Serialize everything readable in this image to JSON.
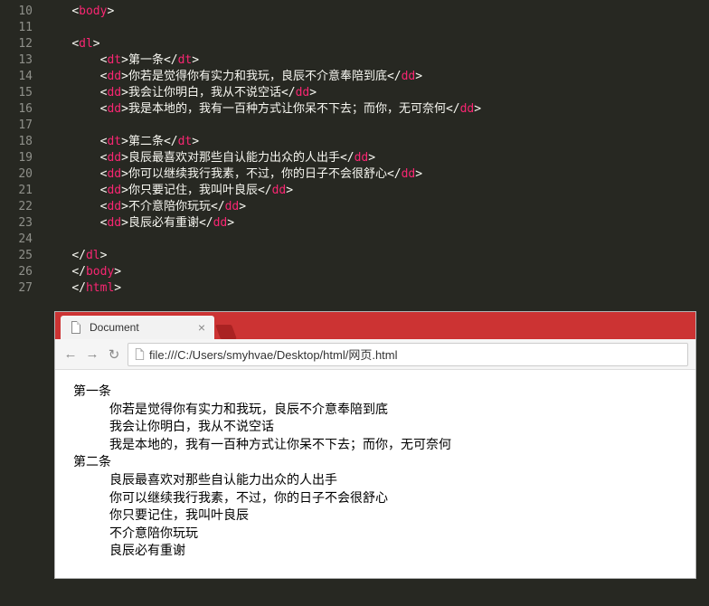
{
  "editor": {
    "lines": [
      {
        "n": 10,
        "indent": 1,
        "type": "open",
        "tag": "body"
      },
      {
        "n": 11,
        "indent": 0,
        "type": "blank"
      },
      {
        "n": 12,
        "indent": 1,
        "type": "open",
        "tag": "dl"
      },
      {
        "n": 13,
        "indent": 2,
        "type": "wrap",
        "tag": "dt",
        "text": "第一条"
      },
      {
        "n": 14,
        "indent": 2,
        "type": "wrap",
        "tag": "dd",
        "text": "你若是觉得你有实力和我玩，良辰不介意奉陪到底"
      },
      {
        "n": 15,
        "indent": 2,
        "type": "wrap",
        "tag": "dd",
        "text": "我会让你明白，我从不说空话"
      },
      {
        "n": 16,
        "indent": 2,
        "type": "wrap",
        "tag": "dd",
        "text": "我是本地的，我有一百种方式让你呆不下去；而你，无可奈何"
      },
      {
        "n": 17,
        "indent": 0,
        "type": "blank"
      },
      {
        "n": 18,
        "indent": 2,
        "type": "wrap",
        "tag": "dt",
        "text": "第二条"
      },
      {
        "n": 19,
        "indent": 2,
        "type": "wrap",
        "tag": "dd",
        "text": "良辰最喜欢对那些自认能力出众的人出手"
      },
      {
        "n": 20,
        "indent": 2,
        "type": "wrap",
        "tag": "dd",
        "text": "你可以继续我行我素，不过，你的日子不会很舒心"
      },
      {
        "n": 21,
        "indent": 2,
        "type": "wrap",
        "tag": "dd",
        "text": "你只要记住，我叫叶良辰"
      },
      {
        "n": 22,
        "indent": 2,
        "type": "wrap",
        "tag": "dd",
        "text": "不介意陪你玩玩"
      },
      {
        "n": 23,
        "indent": 2,
        "type": "wrap",
        "tag": "dd",
        "text": "良辰必有重谢"
      },
      {
        "n": 24,
        "indent": 0,
        "type": "blank"
      },
      {
        "n": 25,
        "indent": 1,
        "type": "close",
        "tag": "dl"
      },
      {
        "n": 26,
        "indent": 1,
        "type": "close",
        "tag": "body"
      },
      {
        "n": 27,
        "indent": 1,
        "type": "close",
        "tag": "html"
      }
    ]
  },
  "browser": {
    "tab_title": "Document",
    "url": "file:///C:/Users/smyhvae/Desktop/html/网页.html",
    "sections": [
      {
        "title": "第一条",
        "items": [
          "你若是觉得你有实力和我玩，良辰不介意奉陪到底",
          "我会让你明白，我从不说空话",
          "我是本地的，我有一百种方式让你呆不下去；而你，无可奈何"
        ]
      },
      {
        "title": "第二条",
        "items": [
          "良辰最喜欢对那些自认能力出众的人出手",
          "你可以继续我行我素，不过，你的日子不会很舒心",
          "你只要记住，我叫叶良辰",
          "不介意陪你玩玩",
          "良辰必有重谢"
        ]
      }
    ]
  }
}
